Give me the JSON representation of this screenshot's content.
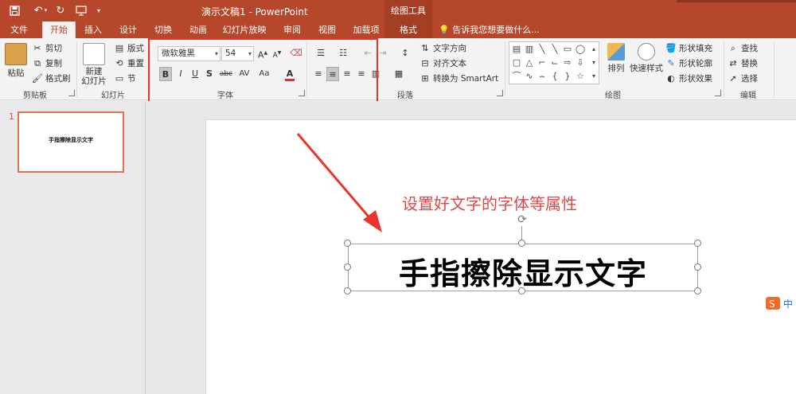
{
  "titlebar": {
    "document_title": "演示文稿1 - PowerPoint",
    "context_label": "绘图工具"
  },
  "tabs": [
    {
      "label": "文件"
    },
    {
      "label": "开始"
    },
    {
      "label": "插入"
    },
    {
      "label": "设计"
    },
    {
      "label": "切换"
    },
    {
      "label": "动画"
    },
    {
      "label": "幻灯片放映"
    },
    {
      "label": "审阅"
    },
    {
      "label": "视图"
    },
    {
      "label": "加载项"
    },
    {
      "label": "格式"
    }
  ],
  "tell_me": "告诉我您想要做什么...",
  "groups": {
    "clipboard": {
      "label": "剪贴板",
      "paste": "粘贴",
      "cut": "剪切",
      "copy": "复制",
      "format_painter": "格式刷"
    },
    "slides": {
      "label": "幻灯片",
      "new_slide": "新建\n幻灯片",
      "layout": "版式",
      "reset": "重置",
      "section": "节"
    },
    "font": {
      "label": "字体",
      "font_name": "微软雅黑",
      "font_size": "54",
      "bold": "B",
      "italic": "I",
      "underline": "U",
      "strike": "S",
      "abc": "abc",
      "spacing": "AV",
      "case": "Aa",
      "color": "A"
    },
    "paragraph": {
      "label": "段落",
      "text_direction": "文字方向",
      "align_text": "对齐文本",
      "convert_smartart": "转换为 SmartArt"
    },
    "drawing": {
      "label": "绘图",
      "arrange": "排列",
      "quick_styles": "快速样式",
      "shape_fill": "形状填充",
      "shape_outline": "形状轮廓",
      "shape_effects": "形状效果"
    },
    "editing": {
      "label": "编辑",
      "find": "查找",
      "replace": "替换",
      "select": "选择"
    }
  },
  "slides": [
    {
      "number": "1",
      "title": "手指擦除显示文字"
    }
  ],
  "slide": {
    "annotation": "设置好文字的字体等属性",
    "main_text": "手指擦除显示文字"
  },
  "colors": {
    "accent": "#b7472a",
    "highlight": "#e8352d",
    "annotation": "#e04848"
  }
}
